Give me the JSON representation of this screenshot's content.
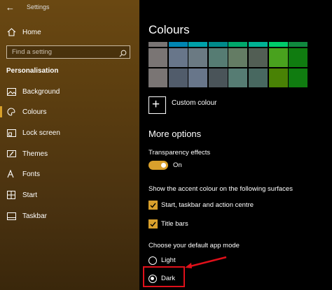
{
  "window": {
    "title": "Settings",
    "back_glyph": "←"
  },
  "sidebar": {
    "home_label": "Home",
    "search_placeholder": "Find a setting",
    "section_title": "Personalisation",
    "items": [
      {
        "label": "Background",
        "icon": "image-icon"
      },
      {
        "label": "Colours",
        "icon": "palette-icon",
        "active": true
      },
      {
        "label": "Lock screen",
        "icon": "lock-screen-icon"
      },
      {
        "label": "Themes",
        "icon": "brush-icon"
      },
      {
        "label": "Fonts",
        "icon": "font-icon"
      },
      {
        "label": "Start",
        "icon": "start-icon"
      },
      {
        "label": "Taskbar",
        "icon": "taskbar-icon"
      }
    ]
  },
  "main": {
    "title": "Colours",
    "swatch_rows": [
      [
        "#4c4a48",
        "#4a5459",
        "#5d5a58",
        "#4a5459",
        "#4c5d56",
        "#3c4e47",
        "#1c9c1c",
        "#1a7a1a"
      ],
      [
        "#7a7574",
        "#68768a",
        "#6b7a83",
        "#567c73",
        "#647c64",
        "#525e54",
        "#49a21e",
        "#107c10"
      ],
      [
        "#7a7574",
        "#515c6b",
        "#68768a",
        "#4a5459",
        "#567c73",
        "#486860",
        "#498205",
        "#107c10"
      ]
    ],
    "swatch_top_strip": [
      "#7a7574",
      "#0086b3",
      "#00a1a9",
      "#008b8b",
      "#00a86b",
      "#00b294",
      "#00cc6a",
      "#10893e"
    ],
    "custom_colour_label": "Custom colour",
    "more_options_title": "More options",
    "transparency": {
      "label": "Transparency effects",
      "state": "On",
      "on": true
    },
    "accent_surfaces_label": "Show the accent colour on the following surfaces",
    "checkboxes": [
      {
        "label": "Start, taskbar and action centre",
        "checked": true
      },
      {
        "label": "Title bars",
        "checked": true
      }
    ],
    "app_mode_label": "Choose your default app mode",
    "app_modes": [
      {
        "label": "Light",
        "selected": false
      },
      {
        "label": "Dark",
        "selected": true
      }
    ],
    "accent_color": "#d9a02c",
    "annotation_color": "#e0101a"
  }
}
